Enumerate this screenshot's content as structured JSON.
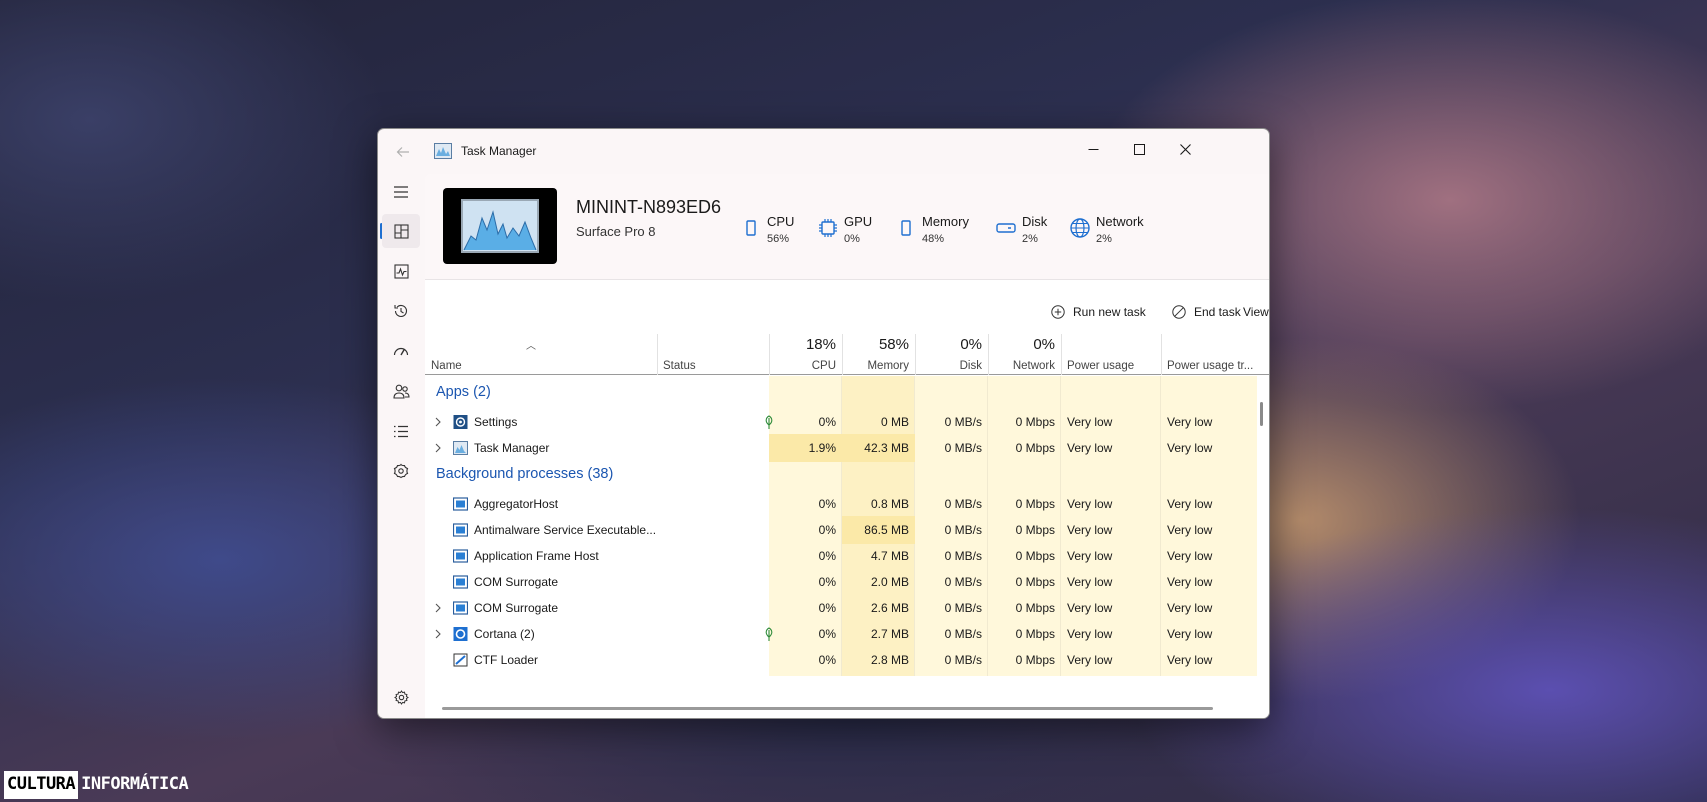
{
  "window": {
    "title": "Task Manager"
  },
  "header": {
    "device_name": "MININT-N893ED6",
    "device_model": "Surface Pro 8",
    "stats": [
      {
        "label": "CPU",
        "value": "56%",
        "icon": "cpu-icon"
      },
      {
        "label": "GPU",
        "value": "0%",
        "icon": "gpu-icon"
      },
      {
        "label": "Memory",
        "value": "48%",
        "icon": "memory-icon"
      },
      {
        "label": "Disk",
        "value": "2%",
        "icon": "disk-icon"
      },
      {
        "label": "Network",
        "value": "2%",
        "icon": "globe-icon"
      }
    ]
  },
  "toolbar": {
    "run_new_task": "Run new task",
    "end_task": "End task",
    "view": "View"
  },
  "table": {
    "columns": [
      {
        "label": "Name",
        "pct": ""
      },
      {
        "label": "Status",
        "pct": ""
      },
      {
        "label": "CPU",
        "pct": "18%"
      },
      {
        "label": "Memory",
        "pct": "58%"
      },
      {
        "label": "Disk",
        "pct": "0%"
      },
      {
        "label": "Network",
        "pct": "0%"
      },
      {
        "label": "Power usage",
        "pct": ""
      },
      {
        "label": "Power usage tr...",
        "pct": ""
      }
    ],
    "groups": [
      {
        "title": "Apps (2)",
        "rows": [
          {
            "name": "Settings",
            "expandable": true,
            "icon": "settings-app-icon",
            "efficiency": true,
            "cpu": "0%",
            "memory": "0 MB",
            "disk": "0 MB/s",
            "network": "0 Mbps",
            "power": "Very low",
            "power_trend": "Very low"
          },
          {
            "name": "Task Manager",
            "expandable": true,
            "icon": "task-manager-icon",
            "efficiency": false,
            "cpu": "1.9%",
            "memory": "42.3 MB",
            "disk": "0 MB/s",
            "network": "0 Mbps",
            "power": "Very low",
            "power_trend": "Very low"
          }
        ]
      },
      {
        "title": "Background processes (38)",
        "rows": [
          {
            "name": "AggregatorHost",
            "expandable": false,
            "icon": "process-icon",
            "efficiency": false,
            "cpu": "0%",
            "memory": "0.8 MB",
            "disk": "0 MB/s",
            "network": "0 Mbps",
            "power": "Very low",
            "power_trend": "Very low"
          },
          {
            "name": "Antimalware Service Executable...",
            "expandable": false,
            "icon": "process-icon",
            "efficiency": false,
            "cpu": "0%",
            "memory": "86.5 MB",
            "disk": "0 MB/s",
            "network": "0 Mbps",
            "power": "Very low",
            "power_trend": "Very low"
          },
          {
            "name": "Application Frame Host",
            "expandable": false,
            "icon": "process-icon",
            "efficiency": false,
            "cpu": "0%",
            "memory": "4.7 MB",
            "disk": "0 MB/s",
            "network": "0 Mbps",
            "power": "Very low",
            "power_trend": "Very low"
          },
          {
            "name": "COM Surrogate",
            "expandable": false,
            "icon": "process-icon",
            "efficiency": false,
            "cpu": "0%",
            "memory": "2.0 MB",
            "disk": "0 MB/s",
            "network": "0 Mbps",
            "power": "Very low",
            "power_trend": "Very low"
          },
          {
            "name": "COM Surrogate",
            "expandable": true,
            "icon": "process-icon",
            "efficiency": false,
            "cpu": "0%",
            "memory": "2.6 MB",
            "disk": "0 MB/s",
            "network": "0 Mbps",
            "power": "Very low",
            "power_trend": "Very low"
          },
          {
            "name": "Cortana (2)",
            "expandable": true,
            "icon": "cortana-icon",
            "efficiency": true,
            "cpu": "0%",
            "memory": "2.7 MB",
            "disk": "0 MB/s",
            "network": "0 Mbps",
            "power": "Very low",
            "power_trend": "Very low"
          },
          {
            "name": "CTF Loader",
            "expandable": false,
            "icon": "ctf-loader-icon",
            "efficiency": false,
            "cpu": "0%",
            "memory": "2.8 MB",
            "disk": "0 MB/s",
            "network": "0 Mbps",
            "power": "Very low",
            "power_trend": "Very low"
          }
        ]
      }
    ]
  },
  "sidebar": {
    "items": [
      "menu-icon",
      "processes-icon",
      "performance-icon",
      "app-history-icon",
      "startup-apps-icon",
      "users-icon",
      "details-icon",
      "services-icon",
      "settings-icon"
    ]
  },
  "watermark": {
    "part1": "CULTURA",
    "part2": "INFORMÁTICA"
  },
  "colors": {
    "accent": "#1e6fd0",
    "heat_light": "#fff8db",
    "heat_strong": "#fbe9a8",
    "group_title": "#1b56b0"
  }
}
